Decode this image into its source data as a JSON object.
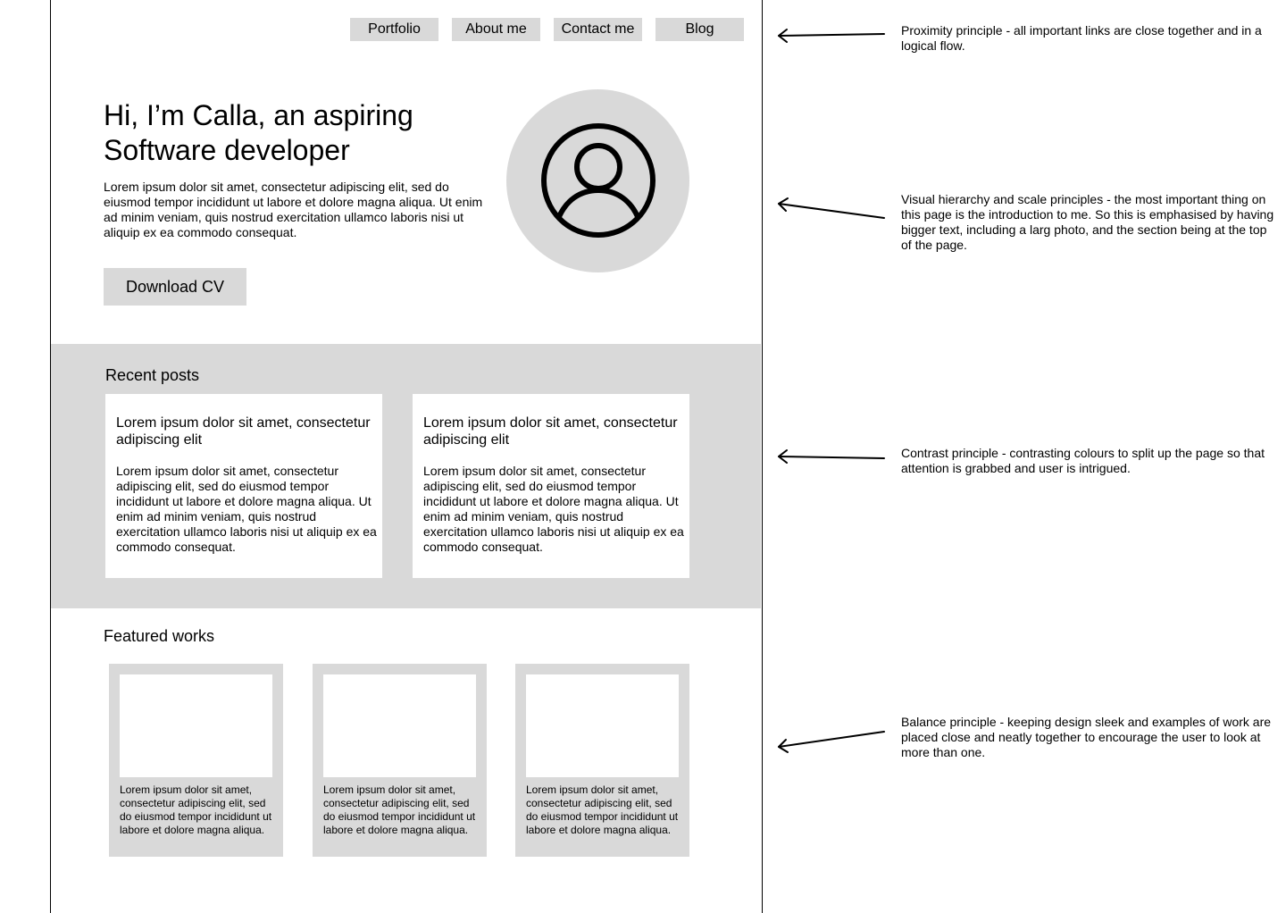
{
  "nav": {
    "items": [
      {
        "label": "Portfolio"
      },
      {
        "label": "About me"
      },
      {
        "label": "Contact me"
      },
      {
        "label": "Blog"
      }
    ]
  },
  "hero": {
    "title": "Hi, I’m Calla, an aspiring Software developer",
    "text": "Lorem ipsum dolor sit amet, consectetur adipiscing elit, sed do eiusmod tempor incididunt ut labore et dolore magna aliqua. Ut enim ad minim veniam, quis nostrud exercitation ullamco laboris nisi ut aliquip ex ea commodo consequat.",
    "download_label": "Download CV",
    "avatar_icon": "user-circle-icon"
  },
  "recent_posts": {
    "heading": "Recent posts",
    "posts": [
      {
        "title": "Lorem ipsum dolor sit amet, consectetur adipiscing elit",
        "body": "Lorem ipsum dolor sit amet, consectetur adipiscing elit, sed do eiusmod tempor incididunt ut labore et dolore magna aliqua. Ut enim ad minim veniam, quis nostrud exercitation ullamco laboris nisi ut aliquip ex ea commodo consequat."
      },
      {
        "title": "Lorem ipsum dolor sit amet, consectetur adipiscing elit",
        "body": "Lorem ipsum dolor sit amet, consectetur adipiscing elit, sed do eiusmod tempor incididunt ut labore et dolore magna aliqua. Ut enim ad minim veniam, quis nostrud exercitation ullamco laboris nisi ut aliquip ex ea commodo consequat."
      }
    ]
  },
  "featured_works": {
    "heading": "Featured works",
    "works": [
      {
        "text": "Lorem ipsum dolor sit amet, consectetur adipiscing elit, sed do eiusmod tempor incididunt ut labore et dolore magna aliqua."
      },
      {
        "text": "Lorem ipsum dolor sit amet, consectetur adipiscing elit, sed do eiusmod tempor incididunt ut labore et dolore magna aliqua."
      },
      {
        "text": "Lorem ipsum dolor sit amet, consectetur adipiscing elit, sed do eiusmod tempor incididunt ut labore et dolore magna aliqua."
      }
    ]
  },
  "annotations": [
    {
      "text": "Proximity principle - all important links are close together and in a logical flow."
    },
    {
      "text": "Visual hierarchy and scale principles - the most important thing on this page is the introduction to me. So this is emphasised by having bigger text, including a larg photo, and the section being at the top of the page."
    },
    {
      "text": "Contrast principle - contrasting colours to split up the page so that attention is grabbed and user is intrigued."
    },
    {
      "text": "Balance principle - keeping design sleek and examples of work are placed close and neatly together to encourage the user to look at more than one."
    }
  ],
  "colors": {
    "placeholder_gray": "#d9d9d9",
    "background": "#ffffff",
    "ink": "#000000"
  }
}
